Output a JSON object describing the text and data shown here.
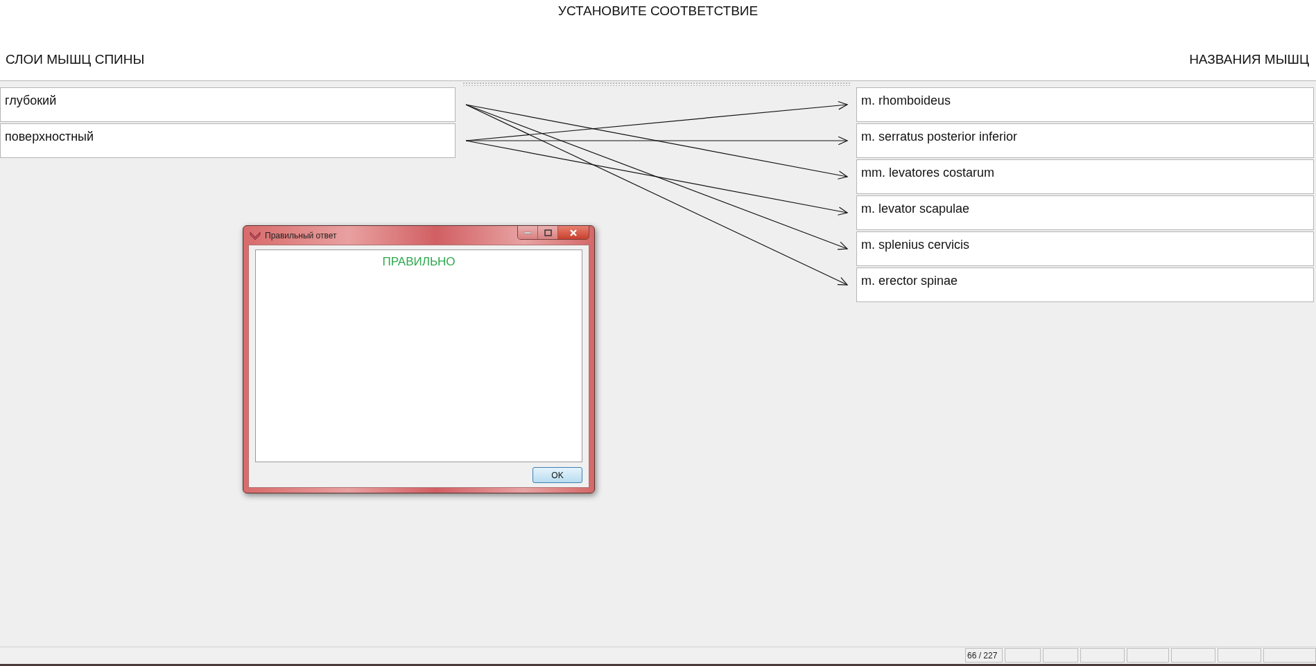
{
  "title": "УСТАНОВИТЕ СООТВЕТСТВИЕ",
  "left_heading": "СЛОИ МЫШЦ СПИНЫ",
  "right_heading": "НАЗВАНИЯ МЫШЦ",
  "left_items": [
    {
      "label": "глубокий",
      "kind": "deep"
    },
    {
      "label": "поверхностный",
      "kind": "superficial"
    }
  ],
  "right_items": [
    {
      "label": "m. rhomboideus",
      "linked_to_deep": false
    },
    {
      "label": "m. serratus posterior inferior",
      "linked_to_deep": false
    },
    {
      "label": "mm. levatores costarum",
      "linked_to_deep": true
    },
    {
      "label": "m. levator scapulae",
      "linked_to_deep": false
    },
    {
      "label": "m. splenius cervicis",
      "linked_to_deep": true
    },
    {
      "label": "m. erector spinae",
      "linked_to_deep": true
    }
  ],
  "dialog": {
    "title": "Правильный ответ",
    "message": "ПРАВИЛЬНО",
    "ok_button": "OK"
  },
  "status_bar": {
    "counter": "66 / 227"
  }
}
